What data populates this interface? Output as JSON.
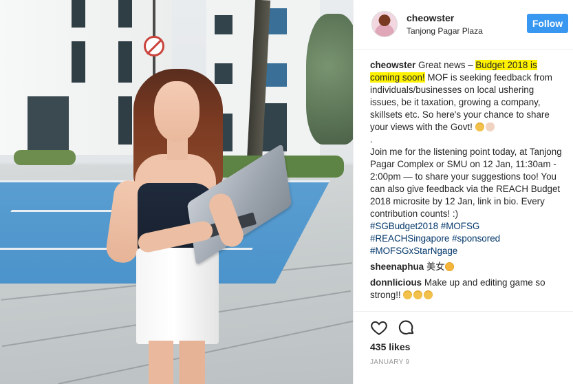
{
  "post": {
    "username": "cheowster",
    "location": "Tanjong Pagar Plaza",
    "follow_label": "Follow",
    "likes": "435 likes",
    "date": "JANUARY 9"
  },
  "caption": {
    "username": "cheowster",
    "part1": "Great news – ",
    "highlight": "Budget 2018 is coming soon!",
    "part2": " MOF is seeking feedback from individuals/businesses on local ushering issues, be it taxation, growing a company, skillsets etc. So here's your chance to share your views with the Govt!",
    "dot": ".",
    "part3": "Join me for the listening point today, at Tanjong Pagar Complex or SMU on 12 Jan, 11:30am - 2:00pm — to share your suggestions too! You can also give feedback via the REACH Budget 2018 microsite by 12 Jan, link in bio. Every contribution counts! :)",
    "hashtags": [
      "#SGBudget2018",
      "#MOFSG",
      "#REACHSingapore",
      "#sponsored",
      "#MOFSGxStarNgage"
    ]
  },
  "comments": [
    {
      "username": "sheenaphua",
      "text": "美女"
    },
    {
      "username": "donnlicious",
      "text": "Make up and editing game so strong!!"
    }
  ],
  "icons": {
    "like": "heart-icon",
    "comment": "comment-bubble-icon",
    "location_sign": "no-parking-sign"
  },
  "colors": {
    "follow_button": "#3897f0",
    "hashtag": "#003569",
    "highlight": "#fff200"
  }
}
